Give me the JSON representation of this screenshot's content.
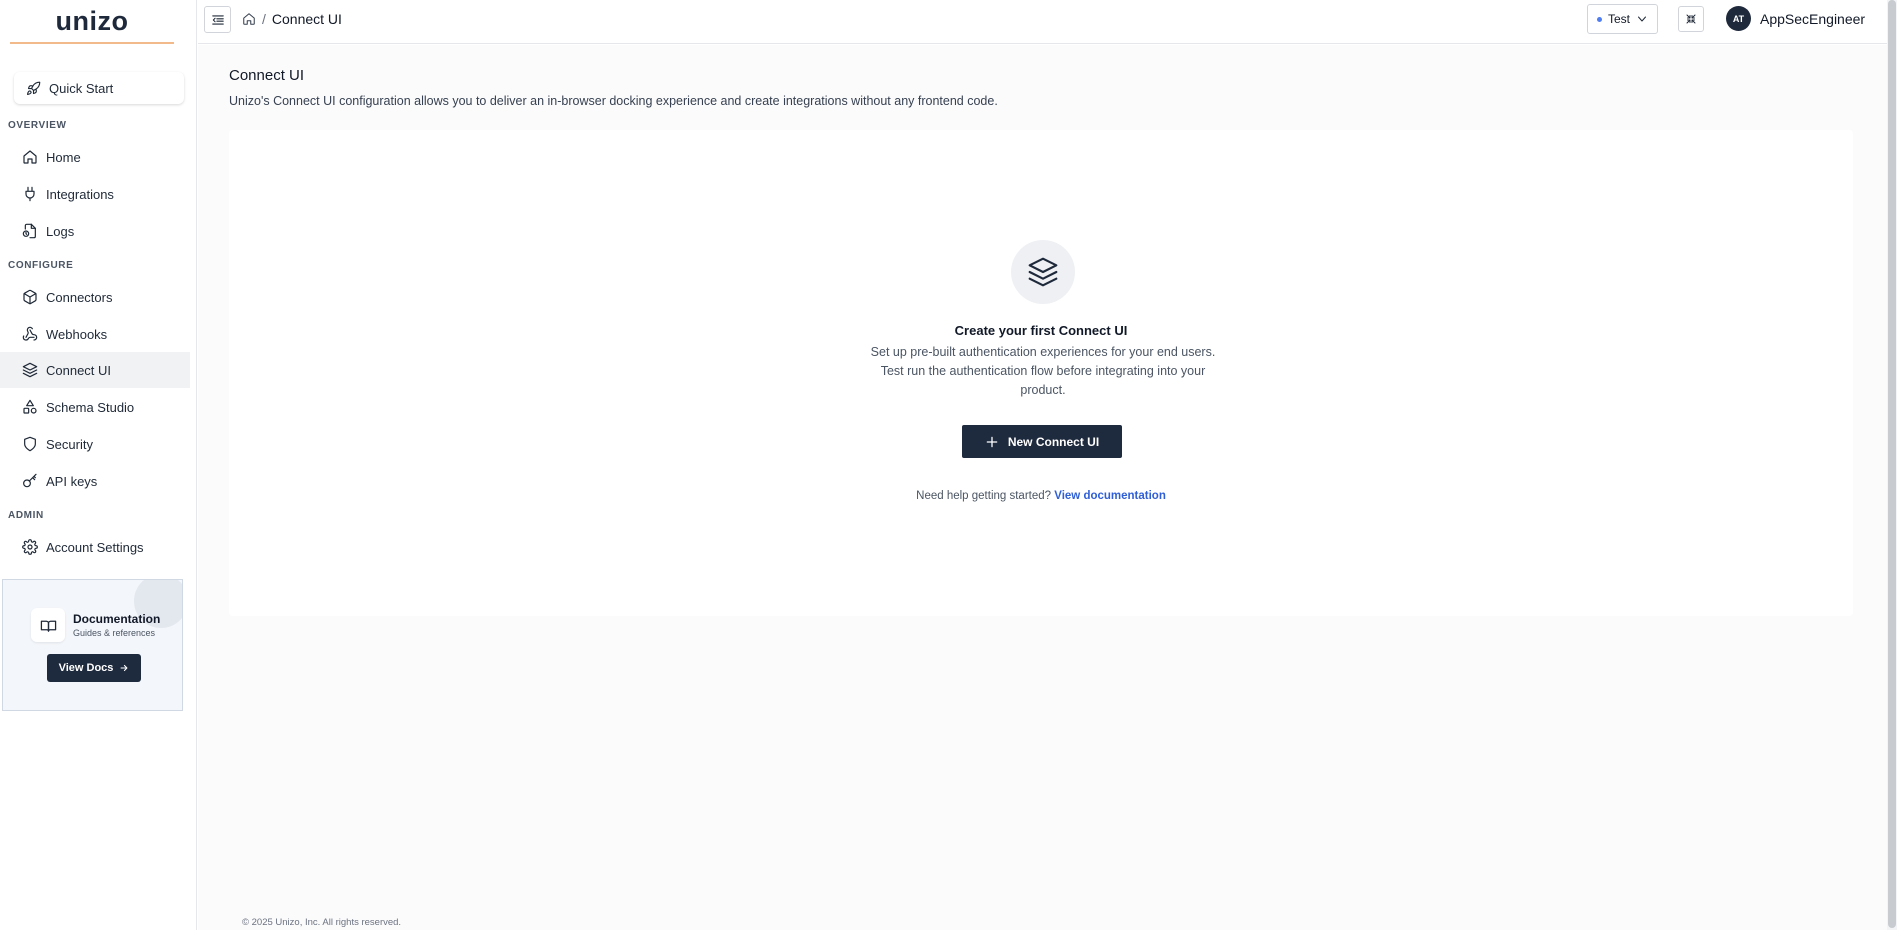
{
  "brand": {
    "logo_text": "unizo",
    "accent_color": "#f2b98b",
    "primary_color": "#1e2a3e",
    "link_color": "#2f5fd7"
  },
  "sidebar": {
    "quick_start": {
      "label": "Quick Start",
      "icon": "rocket-icon"
    },
    "sections": [
      {
        "label": "OVERVIEW",
        "items": [
          {
            "label": "Home",
            "icon": "home-icon"
          },
          {
            "label": "Integrations",
            "icon": "plug-icon"
          },
          {
            "label": "Logs",
            "icon": "file-log-icon"
          }
        ]
      },
      {
        "label": "CONFIGURE",
        "items": [
          {
            "label": "Connectors",
            "icon": "cube-icon"
          },
          {
            "label": "Webhooks",
            "icon": "webhook-icon"
          },
          {
            "label": "Connect UI",
            "icon": "layers-icon",
            "active": true
          },
          {
            "label": "Schema Studio",
            "icon": "shapes-icon"
          },
          {
            "label": "Security",
            "icon": "shield-icon"
          },
          {
            "label": "API keys",
            "icon": "key-icon"
          }
        ]
      },
      {
        "label": "ADMIN",
        "items": [
          {
            "label": "Account Settings",
            "icon": "gear-icon"
          }
        ]
      }
    ],
    "doc_card": {
      "title": "Documentation",
      "subtitle": "Guides & references",
      "button_label": "View Docs",
      "icon": "book-icon"
    }
  },
  "topbar": {
    "toggle_icon": "sidebar-collapse-icon",
    "breadcrumb": {
      "home_icon": "home-icon",
      "separator": "/",
      "current": "Connect UI"
    },
    "environment": {
      "label": "Test",
      "dot_color": "#4f7df2"
    },
    "expand_icon": "fullscreen-icon",
    "user": {
      "initials": "AT",
      "name": "AppSecEngineer"
    }
  },
  "main": {
    "title": "Connect UI",
    "description": "Unizo's Connect UI configuration allows you to deliver an in-browser docking experience and create integrations without any frontend code.",
    "empty_state": {
      "icon": "layers-icon",
      "title": "Create your first Connect UI",
      "description": "Set up pre-built authentication experiences for your end users. Test run the authentication flow before integrating into your product.",
      "button_label": "New Connect UI",
      "help_text": "Need help getting started?",
      "help_link": "View documentation"
    },
    "footer": "© 2025 Unizo, Inc. All rights reserved."
  }
}
